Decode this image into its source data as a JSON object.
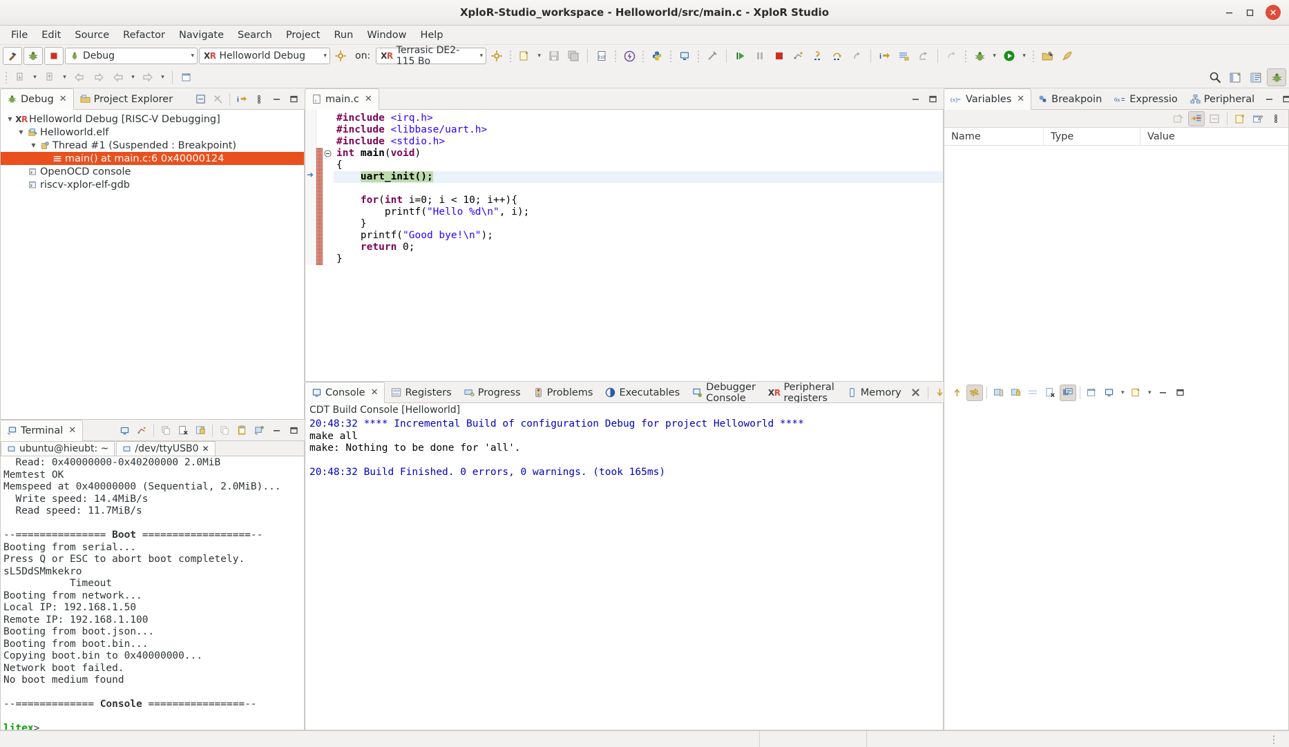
{
  "window": {
    "title": "XploR-Studio_workspace - Helloworld/src/main.c - XploR Studio",
    "minimize": "–",
    "maximize": "□",
    "close": "✕"
  },
  "menubar": {
    "items": [
      "File",
      "Edit",
      "Source",
      "Refactor",
      "Navigate",
      "Search",
      "Project",
      "Run",
      "Window",
      "Help"
    ]
  },
  "toolbar": {
    "build_config": "Debug",
    "launch_config": "Helloworld Debug",
    "on_label": "on:",
    "target": "Terrasic DE2-115 Bo",
    "xr_x": "X",
    "xr_r": "R",
    "icons": [
      "hammer-icon",
      "debug-bug-icon",
      "stop-icon",
      "new-file-icon",
      "save-icon",
      "save-all-icon",
      "binary-file-icon",
      "flash-icon",
      "python-icon",
      "terminal-icon",
      "disconnect-icon",
      "resume-icon",
      "suspend-icon",
      "terminate-icon",
      "disconnect2-icon",
      "step-into-icon",
      "step-over-icon",
      "step-return-icon",
      "instruction-stepping-icon",
      "show-source-icon",
      "drop-to-frame-icon",
      "run-last-tool-icon",
      "debug-launch-icon",
      "run-launch-icon",
      "open-perspective-icon",
      "new-project-icon"
    ]
  },
  "toolbar2": {
    "icons": [
      "next-annotation-icon",
      "previous-annotation-icon",
      "back-icon",
      "forward-icon",
      "prev-edit-icon",
      "next-edit-icon",
      "new-window-icon"
    ]
  },
  "perspective_bar": {
    "icons": [
      "search-icon",
      "open-perspective-icon",
      "cpp-perspective-icon",
      "debug-perspective-icon"
    ]
  },
  "debug_view": {
    "tabs": [
      {
        "label": "Debug",
        "icon": "debug-bug-icon",
        "active": true,
        "closable": true
      },
      {
        "label": "Project Explorer",
        "icon": "project-explorer-icon",
        "active": false,
        "closable": false
      }
    ],
    "actions": [
      "collapse-all-icon",
      "remove-all-terminated-icon",
      "instruction-stepping-icon",
      "view-menu-icon",
      "minimize-icon",
      "maximize-icon"
    ],
    "tree": [
      {
        "level": 1,
        "twisty": "▼",
        "icon": "xr-launch-icon",
        "label": "Helloworld Debug [RISC-V Debugging]",
        "selected": false
      },
      {
        "level": 2,
        "twisty": "▼",
        "icon": "process-icon",
        "label": "Helloworld.elf",
        "selected": false
      },
      {
        "level": 3,
        "twisty": "▼",
        "icon": "thread-icon",
        "label": "Thread #1 (Suspended : Breakpoint)",
        "selected": false
      },
      {
        "level": 4,
        "twisty": "",
        "icon": "stackframe-icon",
        "label": "main() at main.c:6 0x40000124",
        "selected": true
      },
      {
        "level": 2,
        "twisty": "",
        "icon": "console-icon",
        "label": "OpenOCD console",
        "selected": false
      },
      {
        "level": 2,
        "twisty": "",
        "icon": "console-icon",
        "label": "riscv-xplor-elf-gdb",
        "selected": false
      }
    ]
  },
  "editor": {
    "tab": {
      "label": "main.c",
      "icon": "c-file-icon",
      "closable": true
    },
    "actions": [
      "minimize-icon",
      "maximize-icon"
    ],
    "lines": [
      {
        "tokens": [
          {
            "t": "#include ",
            "c": "pp"
          },
          {
            "t": "<irq.h>",
            "c": "inc"
          }
        ]
      },
      {
        "tokens": [
          {
            "t": "#include ",
            "c": "pp"
          },
          {
            "t": "<libbase/uart.h>",
            "c": "inc"
          }
        ]
      },
      {
        "tokens": [
          {
            "t": "#include ",
            "c": "pp"
          },
          {
            "t": "<stdio.h>",
            "c": "inc"
          }
        ]
      },
      {
        "tokens": [
          {
            "t": "int ",
            "c": "kw"
          },
          {
            "t": "main",
            "c": "fn-bold"
          },
          {
            "t": "(",
            "c": "plain"
          },
          {
            "t": "void",
            "c": "kw"
          },
          {
            "t": ")",
            "c": "plain"
          }
        ],
        "fold": true
      },
      {
        "tokens": [
          {
            "t": "{",
            "c": "plain"
          }
        ]
      },
      {
        "tokens": [
          {
            "t": "    ",
            "c": "plain"
          },
          {
            "t": "uart_init();",
            "c": "exec"
          }
        ],
        "current": true,
        "arrow": true
      },
      {
        "tokens": []
      },
      {
        "tokens": [
          {
            "t": "    ",
            "c": "plain"
          },
          {
            "t": "for",
            "c": "kw"
          },
          {
            "t": "(",
            "c": "plain"
          },
          {
            "t": "int",
            "c": "kw"
          },
          {
            "t": " i=0; i < 10; i++){",
            "c": "plain"
          }
        ]
      },
      {
        "tokens": [
          {
            "t": "        printf(",
            "c": "plain"
          },
          {
            "t": "\"Hello %d\\n\"",
            "c": "str"
          },
          {
            "t": ", i);",
            "c": "plain"
          }
        ]
      },
      {
        "tokens": [
          {
            "t": "    }",
            "c": "plain"
          }
        ]
      },
      {
        "tokens": [
          {
            "t": "    printf(",
            "c": "plain"
          },
          {
            "t": "\"Good bye!\\n\"",
            "c": "str"
          },
          {
            "t": ");",
            "c": "plain"
          }
        ]
      },
      {
        "tokens": [
          {
            "t": "    ",
            "c": "plain"
          },
          {
            "t": "return",
            "c": "kw"
          },
          {
            "t": " 0;",
            "c": "plain"
          }
        ]
      },
      {
        "tokens": [
          {
            "t": "}",
            "c": "plain"
          }
        ]
      }
    ]
  },
  "variables_view": {
    "tabs": [
      {
        "label": "Variables",
        "icon": "variables-icon",
        "active": true,
        "closable": true
      },
      {
        "label": "Breakpoin",
        "icon": "breakpoint-icon",
        "active": false,
        "closable": false
      },
      {
        "label": "Expressio",
        "icon": "expressions-icon",
        "active": false,
        "closable": false
      },
      {
        "label": "Peripheral",
        "icon": "peripherals-icon",
        "active": false,
        "closable": false
      }
    ],
    "actions": [
      "minimize-icon",
      "maximize-icon"
    ],
    "toolbar_icons": [
      "collapse-all-icon",
      "show-type-names-icon",
      "collapse-icon",
      "new-var-icon",
      "edit-var-icon",
      "view-menu-icon"
    ],
    "columns": [
      "Name",
      "Type",
      "Value"
    ],
    "rows": []
  },
  "console_view": {
    "tabs": [
      {
        "label": "Console",
        "icon": "console-icon",
        "active": true,
        "closable": true
      },
      {
        "label": "Registers",
        "icon": "registers-icon",
        "active": false,
        "closable": false
      },
      {
        "label": "Progress",
        "icon": "progress-icon",
        "active": false,
        "closable": false
      },
      {
        "label": "Problems",
        "icon": "problems-icon",
        "active": false,
        "closable": false
      },
      {
        "label": "Executables",
        "icon": "executables-icon",
        "active": false,
        "closable": false
      },
      {
        "label": "Debugger Console",
        "icon": "debugger-console-icon",
        "active": false,
        "closable": false
      },
      {
        "label": "Peripheral registers",
        "icon": "xr-icon",
        "active": false,
        "closable": false
      },
      {
        "label": "Memory",
        "icon": "memory-icon",
        "active": false,
        "closable": false
      }
    ],
    "actions": [
      "clear-console-icon",
      "scroll-lock-icon",
      "pin-console-icon",
      "display-selected-console-icon",
      "new-console-view-icon",
      "open-console-icon",
      "minimize-icon",
      "maximize-icon"
    ],
    "subtitle": "CDT Build Console [Helloworld]",
    "output": [
      {
        "text": "20:48:32 **** Incremental Build of configuration Debug for project Helloworld ****",
        "color": "blue"
      },
      {
        "text": "make all",
        "color": "black"
      },
      {
        "text": "make: Nothing to be done for 'all'.",
        "color": "black"
      },
      {
        "text": "",
        "color": "black"
      },
      {
        "text": "20:48:32 Build Finished. 0 errors, 0 warnings. (took 165ms)",
        "color": "blue"
      }
    ]
  },
  "terminal_view": {
    "tabs": [
      {
        "label": "Terminal",
        "icon": "terminal-icon",
        "active": true,
        "closable": true
      }
    ],
    "actions": [
      "open-terminal-icon",
      "new-terminal-connection-icon",
      "copy-icon",
      "paste-icon",
      "scroll-lock-icon",
      "copy2-icon",
      "paste2-icon",
      "settings-icon",
      "minimize-icon",
      "maximize-icon"
    ],
    "session_tabs": [
      {
        "label": "ubuntu@hieubt: ~",
        "icon": "terminal-icon",
        "active": false,
        "closable": false
      },
      {
        "label": "/dev/ttyUSB0",
        "icon": "terminal-icon",
        "active": true,
        "closable": true
      }
    ],
    "output": [
      {
        "text": "  Read: 0x40000000-0x40200000 2.0MiB",
        "style": "normal"
      },
      {
        "text": "Memtest OK",
        "style": "normal"
      },
      {
        "text": "Memspeed at 0x40000000 (Sequential, 2.0MiB)...",
        "style": "normal"
      },
      {
        "text": "  Write speed: 14.4MiB/s",
        "style": "normal"
      },
      {
        "text": "  Read speed: 11.7MiB/s",
        "style": "normal"
      },
      {
        "text": "",
        "style": "normal"
      },
      {
        "text": "--=============== Boot ==================--",
        "style": "bold-mid"
      },
      {
        "text": "Booting from serial...",
        "style": "normal"
      },
      {
        "text": "Press Q or ESC to abort boot completely.",
        "style": "normal"
      },
      {
        "text": "sL5DdSMmkekro",
        "style": "normal"
      },
      {
        "text": "           Timeout",
        "style": "normal"
      },
      {
        "text": "Booting from network...",
        "style": "normal"
      },
      {
        "text": "Local IP: 192.168.1.50",
        "style": "normal"
      },
      {
        "text": "Remote IP: 192.168.1.100",
        "style": "normal"
      },
      {
        "text": "Booting from boot.json...",
        "style": "normal"
      },
      {
        "text": "Booting from boot.bin...",
        "style": "normal"
      },
      {
        "text": "Copying boot.bin to 0x40000000...",
        "style": "normal"
      },
      {
        "text": "Network boot failed.",
        "style": "normal"
      },
      {
        "text": "No boot medium found",
        "style": "normal"
      },
      {
        "text": "",
        "style": "normal"
      },
      {
        "text": "--============= Console ================--",
        "style": "bold-mid"
      },
      {
        "text": "",
        "style": "normal"
      },
      {
        "text": "litex>",
        "style": "green-prompt"
      }
    ],
    "boot_banner_word": "Boot",
    "console_banner_word": "Console",
    "prompt": "litex>"
  },
  "colors": {
    "selection": "#e8501e",
    "accent_blue": "#2a00ff",
    "keyword": "#7f0055",
    "exec_line": "#bddcae",
    "current_line": "#eaf2fb",
    "console_blue": "#0000c0",
    "prompt_green": "#00a000",
    "titlebar_close": "#de4c3a"
  }
}
